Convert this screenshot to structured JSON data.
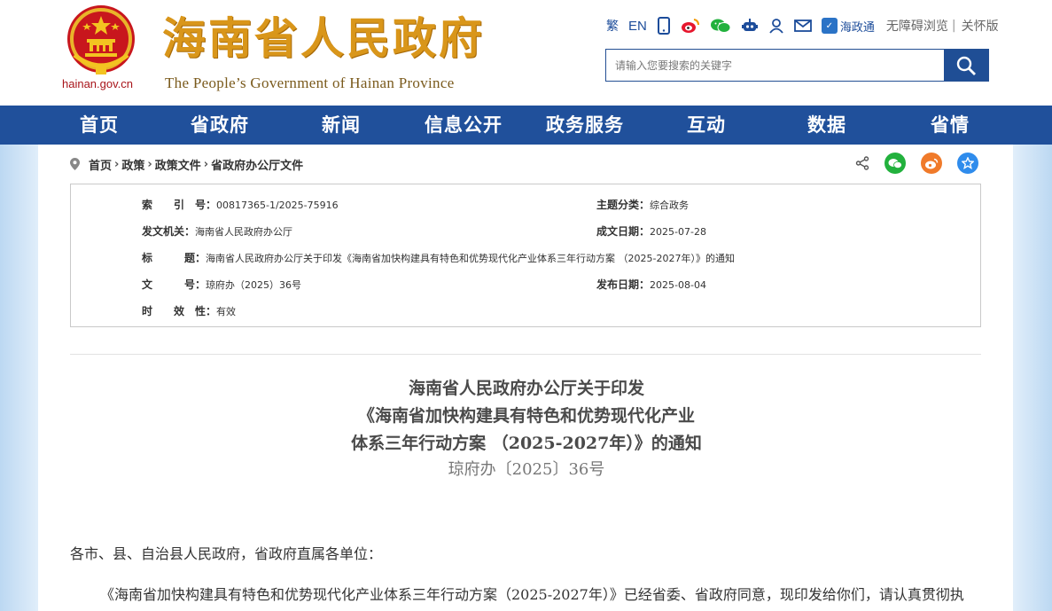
{
  "header": {
    "domain": "hainan.gov.cn",
    "title": "海南省人民政府",
    "subtitle": "The People’s Government  of Hainan Province",
    "top_links": {
      "traditional": "繁",
      "english": "EN",
      "hainantong": "海政通",
      "accessible": "无障碍浏览",
      "divider": "|",
      "elder": "关怀版"
    },
    "search": {
      "placeholder": "请输入您要搜索的关键字"
    }
  },
  "nav": [
    {
      "label": "首页"
    },
    {
      "label": "省政府"
    },
    {
      "label": "新闻"
    },
    {
      "label": "信息公开"
    },
    {
      "label": "政务服务"
    },
    {
      "label": "互动"
    },
    {
      "label": "数据"
    },
    {
      "label": "省情"
    }
  ],
  "breadcrumb": {
    "items": [
      "首页",
      "政策",
      "政策文件",
      "省政府办公厅文件"
    ],
    "separator": "›"
  },
  "meta": {
    "index_label": "索　　引　号：",
    "index_value": "00817365-1/2025-75916",
    "category_label": "主题分类：",
    "category_value": "综合政务",
    "issuer_label": "发文机关：",
    "issuer_value": "海南省人民政府办公厅",
    "created_label": "成文日期：",
    "created_value": "2025-07-28",
    "title_label": "标　　　题：",
    "title_value": "海南省人民政府办公厅关于印发《海南省加快构建具有特色和优势现代化产业体系三年行动方案 （2025-2027年）》的通知",
    "docno_label": "文　　　号：",
    "docno_value": "琼府办（2025）36号",
    "published_label": "发布日期：",
    "published_value": "2025-08-04",
    "validity_label": "时　　效　性：",
    "validity_value": "有效"
  },
  "document": {
    "title_line1": "海南省人民政府办公厅关于印发",
    "title_line2": "《海南省加快构建具有特色和优势现代化产业",
    "title_line3": "体系三年行动方案 （2025-2027年）》的通知",
    "number": "琼府办〔2025〕36号",
    "salutation": "各市、县、自治县人民政府，省政府直属各单位：",
    "body_line1": "《海南省加快构建具有特色和优势现代化产业体系三年行动方案（2025-2027年）》已经省委、省政府同意，现印发给你们，请认真贯彻执"
  },
  "colors": {
    "nav_bg": "#20509b",
    "title_gold": "#d9961a",
    "emblem_red": "#c8161d",
    "wechat_green": "#22b13d",
    "weibo_orange": "#f07a2a",
    "favorite_blue": "#2f8cec"
  },
  "icons": [
    "emblem-icon",
    "mobile-icon",
    "weibo-icon",
    "wechat-icon",
    "robot-icon",
    "user-icon",
    "mail-icon",
    "search-icon",
    "location-pin-icon",
    "share-icon",
    "star-icon"
  ]
}
